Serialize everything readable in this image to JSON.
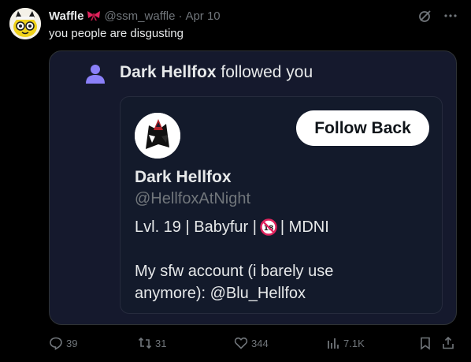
{
  "tweet": {
    "author_name": "Waffle",
    "handle": "@ssm_waffle",
    "separator": "·",
    "date": "Apr 10",
    "text": "you people are disgusting",
    "icons": {
      "avatar": "waffle-avatar",
      "badge": "bow-icon",
      "grok": "grok-icon",
      "more": "more-icon"
    }
  },
  "embed": {
    "follower_name": "Dark Hellfox",
    "follow_text": "followed you",
    "follow_icon": "person-icon",
    "profile": {
      "name": "Dark Hellfox",
      "handle": "@HellfoxAtNight",
      "button_label": "Follow Back",
      "bio_line1_a": "Lvl. 19 | Babyfur |",
      "bio_line1_b": "| MDNI",
      "bio_line2": "My sfw account (i barely use",
      "bio_line3": "anymore): @Blu_Hellfox",
      "bio_icon": "no-under-18-icon"
    }
  },
  "actions": {
    "reply_count": "39",
    "retweet_count": "31",
    "like_count": "344",
    "view_count": "7.1K"
  },
  "colors": {
    "background": "#000000",
    "card": "#15192d",
    "text": "#e7e9ea",
    "muted": "#71767b",
    "person_icon": "#8b80f9"
  }
}
